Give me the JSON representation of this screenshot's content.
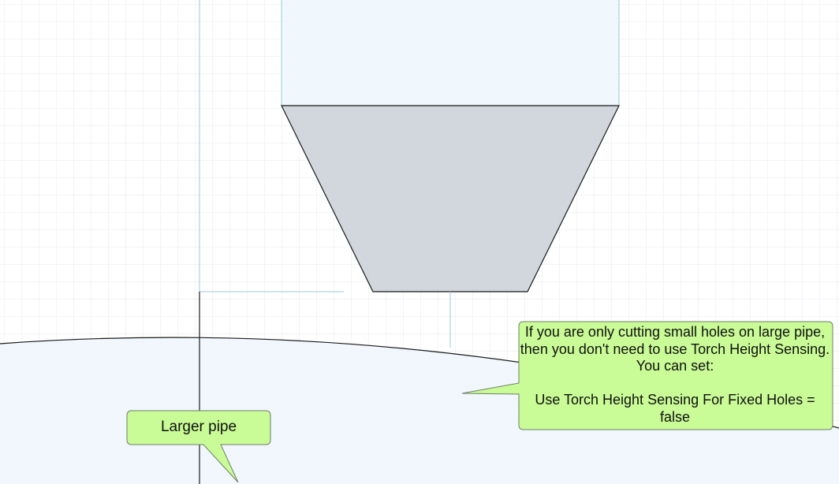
{
  "callouts": {
    "main": {
      "text": "If you are only cutting small holes on large pipe, then you don't need to use Torch Height Sensing.  You can set:\n\nUse Torch Height Sensing For Fixed Holes = false"
    },
    "pipe": {
      "text": "Larger pipe"
    }
  },
  "colors": {
    "grid": "#e4e8ee",
    "light_fill": "#eef6fd",
    "torch_fill": "#ccd3d8",
    "guide_line": "#9cc8d8",
    "callout_fill": "#c9fb96",
    "callout_border": "#6f7f6a",
    "outline": "#1a1a1a"
  }
}
